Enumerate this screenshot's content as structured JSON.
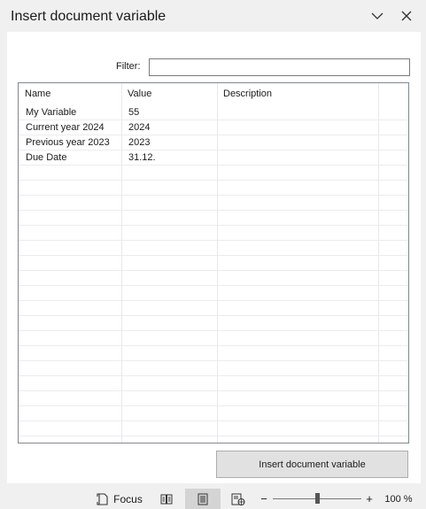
{
  "dialog": {
    "title": "Insert document variable",
    "filter_label": "Filter:",
    "filter_value": "",
    "insert_button": "Insert document variable"
  },
  "grid": {
    "columns": [
      "Name",
      "Value",
      "Description"
    ],
    "rows": [
      {
        "name": "My Variable",
        "value": "55",
        "description": ""
      },
      {
        "name": "Current year 2024",
        "value": "2024",
        "description": ""
      },
      {
        "name": "Previous year 2023",
        "value": "2023",
        "description": ""
      },
      {
        "name": "Due Date",
        "value": "31.12.",
        "description": ""
      }
    ]
  },
  "statusbar": {
    "focus_label": "Focus",
    "zoom_minus": "−",
    "zoom_plus": "+",
    "zoom_level": "100 %",
    "zoom_fraction": 0.5
  },
  "icons": {
    "chevron": "chevron-down-icon",
    "close": "close-icon",
    "focus": "focus-icon",
    "read_mode": "read-mode-icon",
    "print_layout": "print-layout-icon",
    "web_layout": "web-layout-icon"
  }
}
